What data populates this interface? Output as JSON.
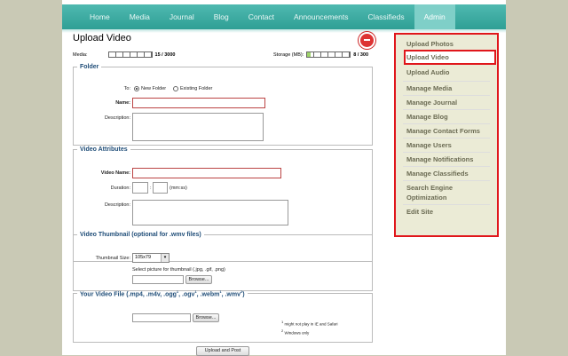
{
  "nav": [
    "Home",
    "Media",
    "Journal",
    "Blog",
    "Contact",
    "Announcements",
    "Classifieds",
    "Admin"
  ],
  "page_title": "Upload Video",
  "media_meter": {
    "label": "Media:",
    "value": "15 / 3000",
    "fraction": 0.005
  },
  "storage_meter": {
    "label": "Storage (MB):",
    "value": "8 / 300",
    "fraction": 0.027
  },
  "folder": {
    "legend": "Folder",
    "to_label": "To:",
    "opt_new": "New Folder",
    "opt_existing": "Existing Folder",
    "name_label": "Name:",
    "desc_label": "Description:"
  },
  "attributes": {
    "legend": "Video Attributes",
    "name_label": "Video Name:",
    "duration_label": "Duration:",
    "duration_sep": ":",
    "duration_hint": "(mm:ss)",
    "desc_label": "Description:"
  },
  "thumbnail": {
    "legend": "Video Thumbnail (optional for .wmv files)",
    "size_label": "Thumbnail Size:",
    "size_value": "105x79",
    "select_hint": "Select picture for thumbnail (.jpg, .gif, .png)",
    "browse": "Browse..."
  },
  "file": {
    "legend_pre": "Your Video File (.mp4, .m4v, .ogg",
    "legend_ogv": ", .ogv",
    "legend_webm": ", .webm",
    "legend_wmv": ", .wmv",
    "legend_close": ")",
    "sup1": "1",
    "sup2": "2",
    "browse": "Browse...",
    "note1": "might not play in IE and Safari",
    "note2": "Windows only"
  },
  "submit": "Upload and Post",
  "sidebar": [
    "Upload Photos",
    "Upload Video",
    "Upload Audio",
    "Manage Media",
    "Manage Journal",
    "Manage Blog",
    "Manage Contact Forms",
    "Manage Users",
    "Manage Notifications",
    "Manage Classifieds",
    "Search Engine Optimization",
    "Edit Site"
  ],
  "colors": {
    "nav": "#2f9f95",
    "highlight": "#e0161b",
    "legend": "#1f4d78",
    "sidebar_bg": "#ebebd6"
  }
}
